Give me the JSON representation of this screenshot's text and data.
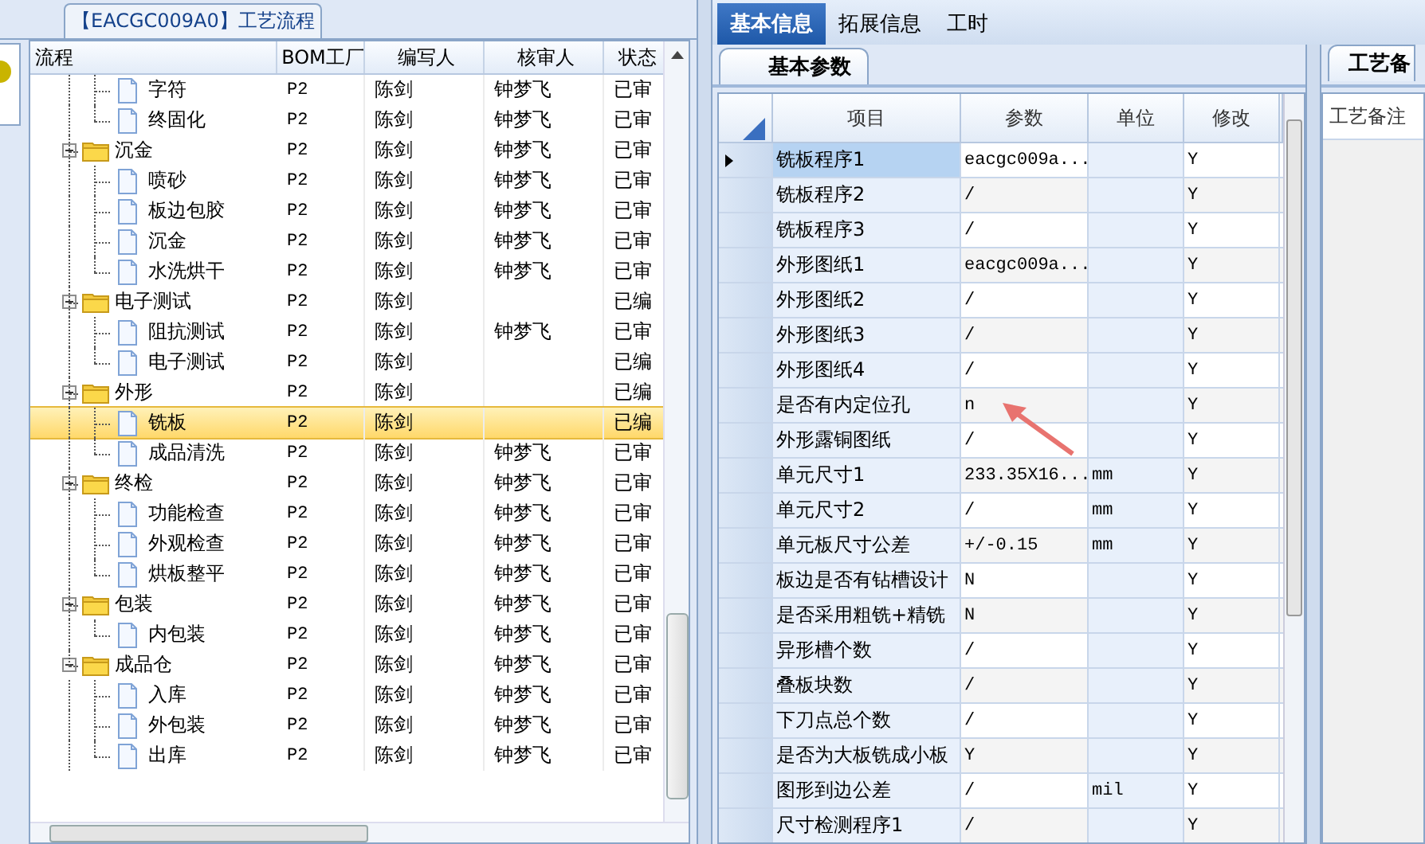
{
  "process_panel": {
    "title": "【EACGC009A0】工艺流程",
    "columns": [
      "流程",
      "BOM工厂",
      "编写人",
      "核审人",
      "状态"
    ],
    "continued_children": [
      {
        "label": "字符",
        "bom": "P2",
        "author": "陈剑",
        "reviewer": "钟梦飞",
        "status": "已审",
        "selected": false
      },
      {
        "label": "终固化",
        "bom": "P2",
        "author": "陈剑",
        "reviewer": "钟梦飞",
        "status": "已审",
        "selected": false
      }
    ],
    "nodes": [
      {
        "label": "沉金",
        "bom": "P2",
        "author": "陈剑",
        "reviewer": "钟梦飞",
        "status": "已审",
        "selected": false,
        "expanded": true,
        "children": [
          {
            "label": "喷砂",
            "bom": "P2",
            "author": "陈剑",
            "reviewer": "钟梦飞",
            "status": "已审",
            "selected": false
          },
          {
            "label": "板边包胶",
            "bom": "P2",
            "author": "陈剑",
            "reviewer": "钟梦飞",
            "status": "已审",
            "selected": false
          },
          {
            "label": "沉金",
            "bom": "P2",
            "author": "陈剑",
            "reviewer": "钟梦飞",
            "status": "已审",
            "selected": false
          },
          {
            "label": "水洗烘干",
            "bom": "P2",
            "author": "陈剑",
            "reviewer": "钟梦飞",
            "status": "已审",
            "selected": false
          }
        ]
      },
      {
        "label": "电子测试",
        "bom": "P2",
        "author": "陈剑",
        "status": "已编",
        "selected": false,
        "expanded": true,
        "children": [
          {
            "label": "阻抗测试",
            "bom": "P2",
            "author": "陈剑",
            "reviewer": "钟梦飞",
            "status": "已审",
            "selected": false
          },
          {
            "label": "电子测试",
            "bom": "P2",
            "author": "陈剑",
            "status": "已编",
            "selected": false
          }
        ]
      },
      {
        "label": "外形",
        "bom": "P2",
        "author": "陈剑",
        "status": "已编",
        "selected": false,
        "expanded": true,
        "children": [
          {
            "label": "铣板",
            "bom": "P2",
            "author": "陈剑",
            "status": "已编",
            "selected": true
          },
          {
            "label": "成品清洗",
            "bom": "P2",
            "author": "陈剑",
            "reviewer": "钟梦飞",
            "status": "已审",
            "selected": false
          }
        ]
      },
      {
        "label": "终检",
        "bom": "P2",
        "author": "陈剑",
        "reviewer": "钟梦飞",
        "status": "已审",
        "selected": false,
        "expanded": true,
        "children": [
          {
            "label": "功能检查",
            "bom": "P2",
            "author": "陈剑",
            "reviewer": "钟梦飞",
            "status": "已审",
            "selected": false
          },
          {
            "label": "外观检查",
            "bom": "P2",
            "author": "陈剑",
            "reviewer": "钟梦飞",
            "status": "已审",
            "selected": false
          },
          {
            "label": "烘板整平",
            "bom": "P2",
            "author": "陈剑",
            "reviewer": "钟梦飞",
            "status": "已审",
            "selected": false
          }
        ]
      },
      {
        "label": "包装",
        "bom": "P2",
        "author": "陈剑",
        "reviewer": "钟梦飞",
        "status": "已审",
        "selected": false,
        "expanded": true,
        "children": [
          {
            "label": "内包装",
            "bom": "P2",
            "author": "陈剑",
            "reviewer": "钟梦飞",
            "status": "已审",
            "selected": false
          }
        ]
      },
      {
        "label": "成品仓",
        "bom": "P2",
        "author": "陈剑",
        "reviewer": "钟梦飞",
        "status": "已审",
        "selected": false,
        "expanded": true,
        "children": [
          {
            "label": "入库",
            "bom": "P2",
            "author": "陈剑",
            "reviewer": "钟梦飞",
            "status": "已审",
            "selected": false
          },
          {
            "label": "外包装",
            "bom": "P2",
            "author": "陈剑",
            "reviewer": "钟梦飞",
            "status": "已审",
            "selected": false
          },
          {
            "label": "出库",
            "bom": "P2",
            "author": "陈剑",
            "reviewer": "钟梦飞",
            "status": "已审",
            "selected": false
          }
        ]
      }
    ]
  },
  "tabs": [
    {
      "label": "基本信息",
      "selected": true
    },
    {
      "label": "拓展信息",
      "selected": false
    },
    {
      "label": "工时",
      "selected": false
    }
  ],
  "params_panel": {
    "tab": "基本参数",
    "columns": [
      "项目",
      "参数",
      "单位",
      "修改"
    ],
    "rows": [
      {
        "item": "铣板程序1",
        "param": "eacgc009a...",
        "unit": "",
        "modify": "Y",
        "selected": true
      },
      {
        "item": "铣板程序2",
        "param": "/",
        "unit": "",
        "modify": "Y",
        "selected": false
      },
      {
        "item": "铣板程序3",
        "param": "/",
        "unit": "",
        "modify": "Y",
        "selected": false
      },
      {
        "item": "外形图纸1",
        "param": "eacgc009a...",
        "unit": "",
        "modify": "Y",
        "selected": false
      },
      {
        "item": "外形图纸2",
        "param": "/",
        "unit": "",
        "modify": "Y",
        "selected": false
      },
      {
        "item": "外形图纸3",
        "param": "/",
        "unit": "",
        "modify": "Y",
        "selected": false
      },
      {
        "item": "外形图纸4",
        "param": "/",
        "unit": "",
        "modify": "Y",
        "selected": false
      },
      {
        "item": "是否有内定位孔",
        "param": "n",
        "unit": "",
        "modify": "Y",
        "selected": false
      },
      {
        "item": "外形露铜图纸",
        "param": "/",
        "unit": "",
        "modify": "Y",
        "selected": false
      },
      {
        "item": "单元尺寸1",
        "param": "233.35X16...",
        "unit": "mm",
        "modify": "Y",
        "selected": false
      },
      {
        "item": "单元尺寸2",
        "param": "/",
        "unit": "mm",
        "modify": "Y",
        "selected": false
      },
      {
        "item": "单元板尺寸公差",
        "param": "+/-0.15",
        "unit": "mm",
        "modify": "Y",
        "selected": false
      },
      {
        "item": "板边是否有钻槽设计",
        "param": "N",
        "unit": "",
        "modify": "Y",
        "selected": false
      },
      {
        "item": "是否采用粗铣+精铣",
        "param": "N",
        "unit": "",
        "modify": "Y",
        "selected": false
      },
      {
        "item": "异形槽个数",
        "param": "/",
        "unit": "",
        "modify": "Y",
        "selected": false
      },
      {
        "item": "叠板块数",
        "param": "/",
        "unit": "",
        "modify": "Y",
        "selected": false
      },
      {
        "item": "下刀点总个数",
        "param": "/",
        "unit": "",
        "modify": "Y",
        "selected": false
      },
      {
        "item": "是否为大板铣成小板",
        "param": "Y",
        "unit": "",
        "modify": "Y",
        "selected": false
      },
      {
        "item": "图形到边公差",
        "param": "/",
        "unit": "mil",
        "modify": "Y",
        "selected": false
      },
      {
        "item": "尺寸检测程序1",
        "param": "/",
        "unit": "",
        "modify": "Y",
        "selected": false
      }
    ]
  },
  "notes_panel": {
    "tab": "工艺备",
    "label": "工艺备注"
  }
}
